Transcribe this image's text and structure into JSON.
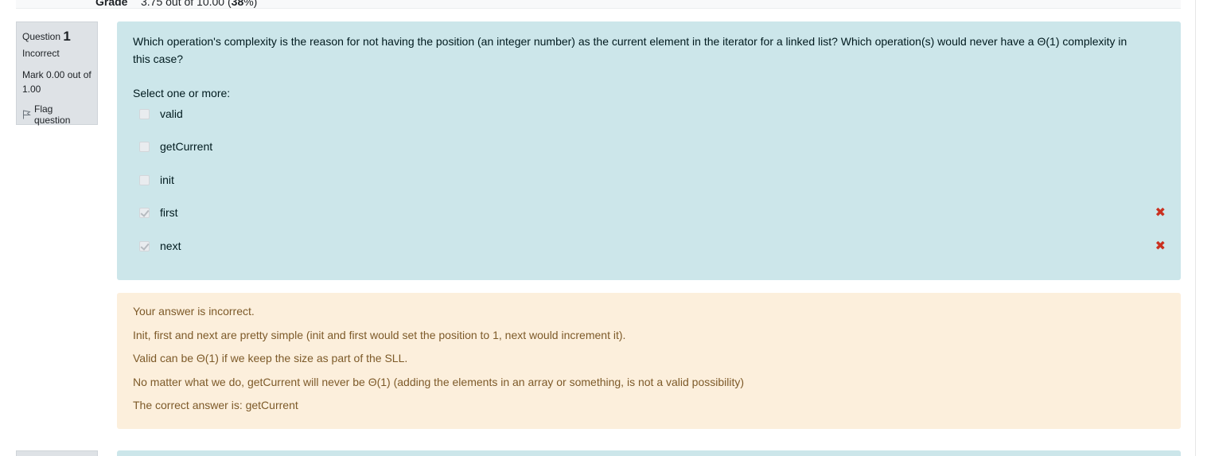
{
  "summary": {
    "grade_label": "Grade",
    "grade_value_pre": "3.75",
    "grade_value_mid": " out of 10.00 (",
    "grade_value_pct": "38",
    "grade_value_post": "%)"
  },
  "question": {
    "label": "Question",
    "number": "1",
    "state": "Incorrect",
    "mark": "Mark 0.00 out of 1.00",
    "flag_label": "Flag question",
    "text": "Which operation's complexity is the reason for not having the position (an integer number) as the current element in the iterator for a linked list? Which operation(s) would never have a Θ(1) complexity in this case?",
    "prompt": "Select one or more:",
    "options": [
      {
        "label": "valid",
        "checked": false,
        "mark": ""
      },
      {
        "label": "getCurrent",
        "checked": false,
        "mark": ""
      },
      {
        "label": "init",
        "checked": false,
        "mark": ""
      },
      {
        "label": "first",
        "checked": true,
        "mark": "✖"
      },
      {
        "label": "next",
        "checked": true,
        "mark": "✖"
      }
    ]
  },
  "feedback": {
    "lines": [
      "Your answer is incorrect.",
      "Init, first and next are pretty simple (init and first would set the position to 1, next would increment it).",
      "Valid can be Θ(1) if we keep the size as part of the SLL.",
      "No matter what we do, getCurrent will never be Θ(1) (adding the elements in an array or something, is not a valid possibility)",
      "The correct answer is: getCurrent"
    ]
  },
  "colors": {
    "formulation_bg": "#cce6ea",
    "feedback_bg": "#fcefdc",
    "info_bg": "#dee2e6",
    "incorrect_mark": "#ca3120"
  }
}
